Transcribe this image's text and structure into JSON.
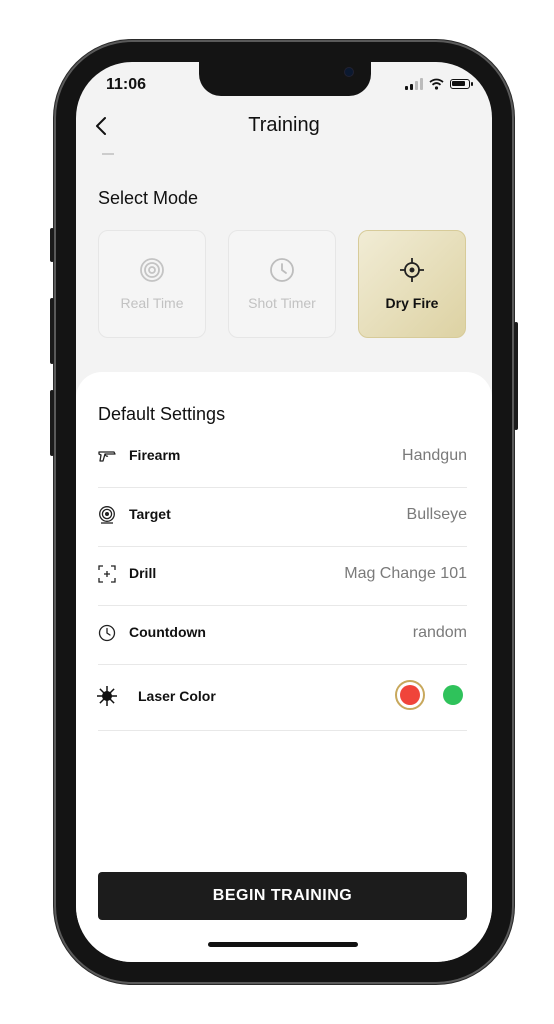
{
  "status_bar": {
    "time": "11:06"
  },
  "header": {
    "title": "Training"
  },
  "mode_section": {
    "title": "Select Mode",
    "modes": [
      {
        "label": "Real Time",
        "icon": "target-icon",
        "selected": false
      },
      {
        "label": "Shot Timer",
        "icon": "clock-icon",
        "selected": false
      },
      {
        "label": "Dry Fire",
        "icon": "crosshair-icon",
        "selected": true
      }
    ]
  },
  "settings": {
    "title": "Default Settings",
    "rows": [
      {
        "label": "Firearm",
        "value": "Handgun",
        "icon": "handgun-icon"
      },
      {
        "label": "Target",
        "value": "Bullseye",
        "icon": "bullseye-icon"
      },
      {
        "label": "Drill",
        "value": "Mag Change 101",
        "icon": "drill-frame-icon"
      },
      {
        "label": "Countdown",
        "value": "random",
        "icon": "clock-icon"
      }
    ],
    "laser": {
      "label": "Laser Color",
      "icon": "laser-burst-icon",
      "colors": [
        {
          "hex": "#f0443a",
          "selected": true
        },
        {
          "hex": "#2fc25b",
          "selected": false
        }
      ]
    }
  },
  "actions": {
    "begin_label": "BEGIN TRAINING"
  },
  "colors": {
    "accent_gold": "#ddd2a3",
    "button_dark": "#1c1c1c"
  }
}
